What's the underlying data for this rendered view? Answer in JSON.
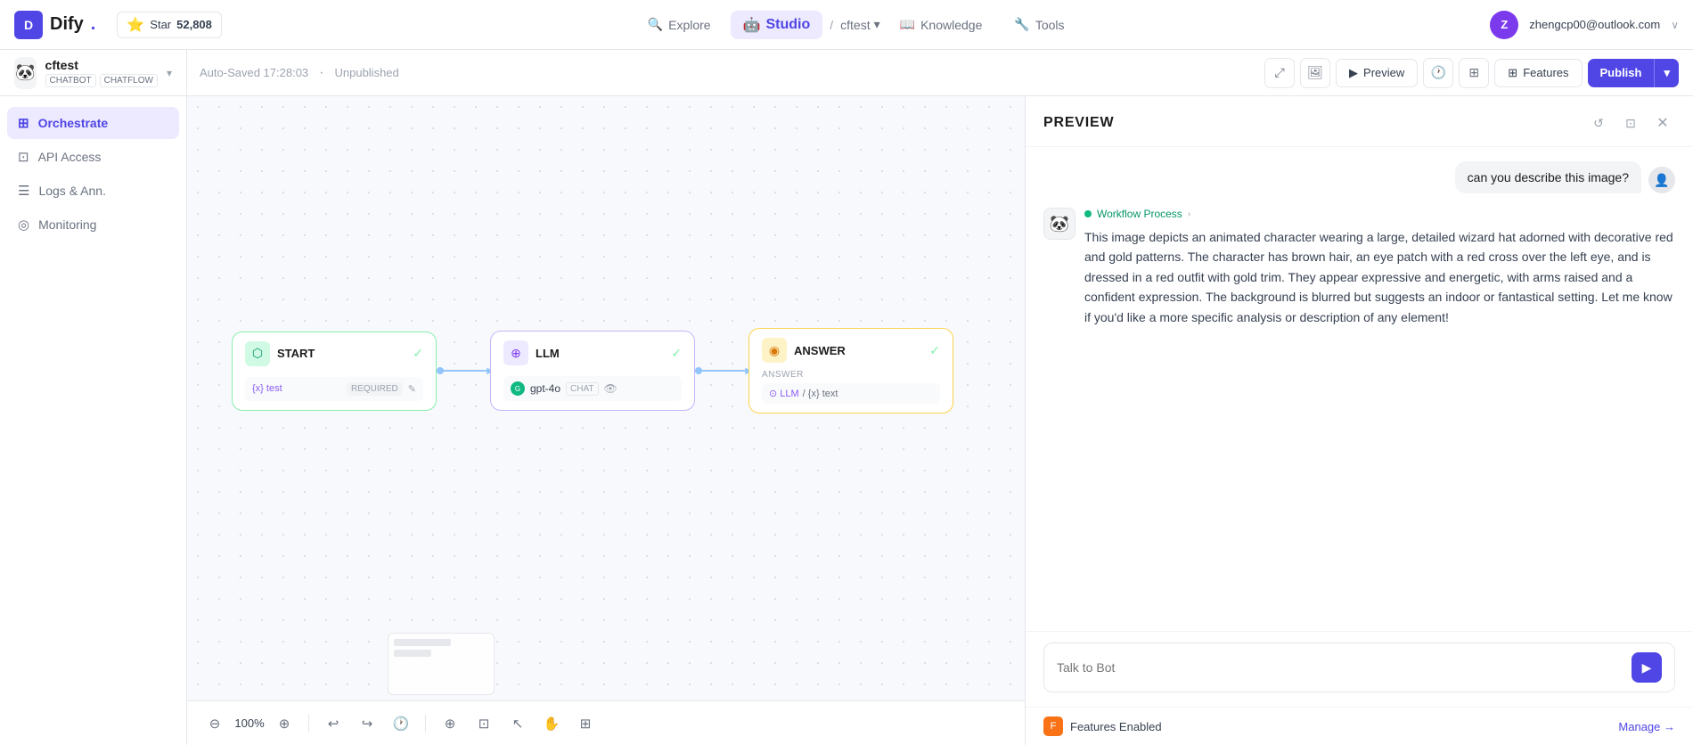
{
  "app": {
    "logo": "D",
    "name": "Dify",
    "name_dot": ".",
    "github": {
      "label": "Star",
      "count": "52,808"
    }
  },
  "nav": {
    "explore": "Explore",
    "studio": "Studio",
    "divider": "/",
    "cftest": "cftest",
    "knowledge": "Knowledge",
    "tools": "Tools",
    "user_initial": "Z",
    "user_email": "zhengcp00@outlook.com",
    "user_chevron": "∨"
  },
  "secondary_nav": {
    "auto_saved": "Auto-Saved 17:28:03",
    "dot": "·",
    "unpublished": "Unpublished",
    "preview_label": "Preview",
    "features_label": "Features",
    "publish_label": "Publish"
  },
  "app_info": {
    "name": "cftest",
    "tag1": "CHATBOT",
    "tag2": "CHATFLOW",
    "emoji": "🐼"
  },
  "sidebar": {
    "items": [
      {
        "id": "orchestrate",
        "label": "Orchestrate",
        "icon": "⊞",
        "active": true
      },
      {
        "id": "api-access",
        "label": "API Access",
        "icon": "⊡",
        "active": false
      },
      {
        "id": "logs-ann",
        "label": "Logs & Ann.",
        "icon": "☰",
        "active": false
      },
      {
        "id": "monitoring",
        "label": "Monitoring",
        "icon": "◎",
        "active": false
      }
    ]
  },
  "flow": {
    "nodes": [
      {
        "id": "start",
        "type": "start",
        "title": "START",
        "field_label": "{x} test",
        "field_badge": "REQUIRED",
        "icon": "⬡",
        "check": "✓"
      },
      {
        "id": "llm",
        "type": "llm",
        "title": "LLM",
        "model": "gpt-4o",
        "model_badge": "CHAT",
        "icon": "⊕",
        "check": "✓"
      },
      {
        "id": "answer",
        "type": "answer",
        "title": "ANSWER",
        "answer_section_label": "ANSWER",
        "answer_ref1": "⊙ LLM",
        "answer_ref2": "/ {x} text",
        "icon": "◉",
        "check": "✓"
      }
    ]
  },
  "zoom": {
    "level": "100%"
  },
  "preview": {
    "title": "PREVIEW",
    "workflow_badge": "Workflow Process",
    "workflow_chevron": "›",
    "user_message": "can you describe this image?",
    "bot_response": "This image depicts an animated character wearing a large, detailed wizard hat adorned with decorative red and gold patterns. The character has brown hair, an eye patch with a red cross over the left eye, and is dressed in a red outfit with gold trim. They appear expressive and energetic, with arms raised and a confident expression. The background is blurred but suggests an indoor or fantastical setting. Let me know if you'd like a more specific analysis or description of any element!",
    "chat_placeholder": "Talk to Bot",
    "features_label": "Features Enabled",
    "manage_label": "Manage →"
  }
}
